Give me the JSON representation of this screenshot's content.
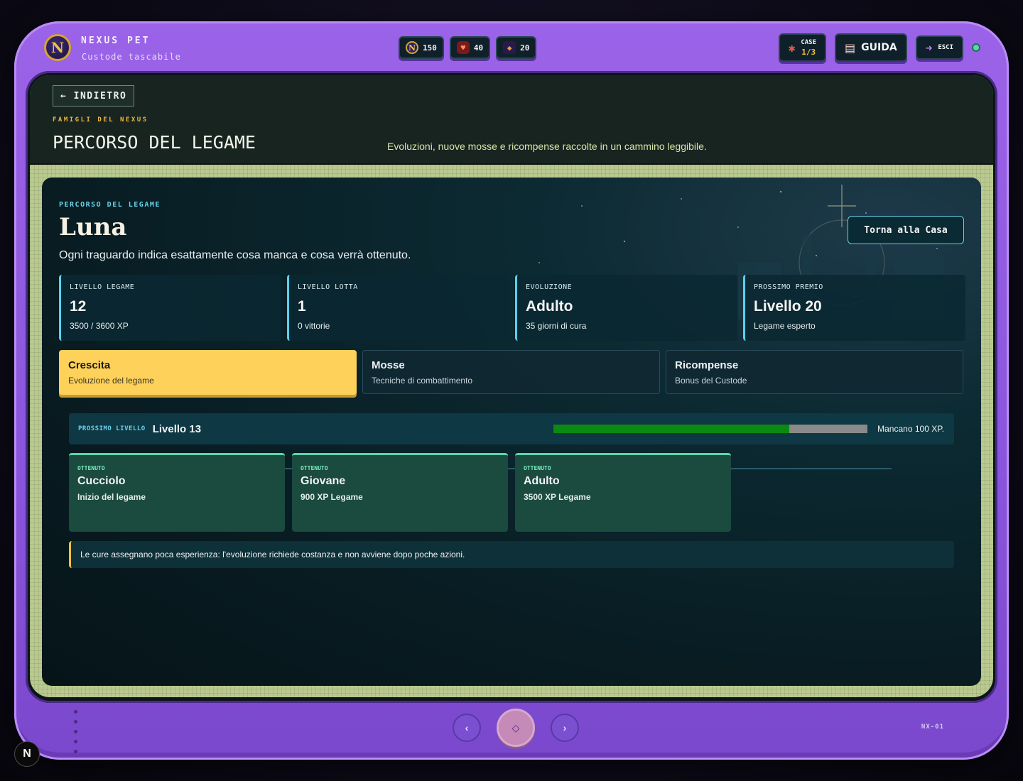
{
  "brand": {
    "logo_letter": "N",
    "title": "NEXUS PET",
    "subtitle": "Custode tascabile"
  },
  "resources": [
    {
      "icon": "nexus-coin-icon",
      "value": "150"
    },
    {
      "icon": "heart-potion-icon",
      "value": "40"
    },
    {
      "icon": "crystal-icon",
      "value": "20"
    }
  ],
  "toolbar": {
    "case_label": "CASE",
    "case_value": "1/3",
    "guide_label": "GUIDA",
    "exit_label": "ESCI"
  },
  "header": {
    "back_label": "← INDIETRO",
    "eyebrow": "FAMIGLI DEL NEXUS",
    "title": "PERCORSO DEL LEGAME",
    "description": "Evoluzioni, nuove mosse e ricompense raccolte in un cammino leggibile."
  },
  "pet": {
    "eyebrow": "PERCORSO DEL LEGAME",
    "name": "Luna",
    "description": "Ogni traguardo indica esattamente cosa manca e cosa verrà ottenuto.",
    "home_button": "Torna alla Casa"
  },
  "stats": [
    {
      "label": "LIVELLO LEGAME",
      "value": "12",
      "sub": "3500 / 3600 XP"
    },
    {
      "label": "LIVELLO LOTTA",
      "value": "1",
      "sub": "0 vittorie"
    },
    {
      "label": "EVOLUZIONE",
      "value": "Adulto",
      "sub": "35 giorni di cura"
    },
    {
      "label": "PROSSIMO PREMIO",
      "value": "Livello 20",
      "sub": "Legame esperto"
    }
  ],
  "tabs": [
    {
      "title": "Crescita",
      "sub": "Evoluzione del legame",
      "active": true
    },
    {
      "title": "Mosse",
      "sub": "Tecniche di combattimento",
      "active": false
    },
    {
      "title": "Ricompense",
      "sub": "Bonus del Custode",
      "active": false
    }
  ],
  "next_level": {
    "label": "PROSSIMO LIVELLO",
    "value": "Livello 13",
    "progress_percent": 75,
    "missing": "Mancano 100 XP."
  },
  "milestones": [
    {
      "state": "OTTENUTO",
      "name": "Cucciolo",
      "requirement": "Inizio del legame"
    },
    {
      "state": "OTTENUTO",
      "name": "Giovane",
      "requirement": "900 XP Legame"
    },
    {
      "state": "OTTENUTO",
      "name": "Adulto",
      "requirement": "3500 XP Legame"
    }
  ],
  "note": "Le cure assegnano poca esperienza: l'evoluzione richiede costanza e non avviene dopo poche azioni.",
  "device": {
    "prev_glyph": "‹",
    "center_glyph": "◇",
    "next_glyph": "›",
    "model": "NX-01"
  },
  "corner_badge": "N"
}
